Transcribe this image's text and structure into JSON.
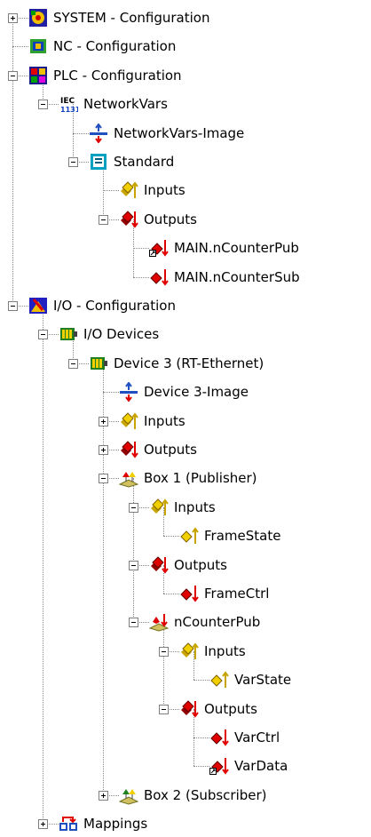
{
  "tree": {
    "selected_index": 30,
    "nodes": [
      {
        "label": "SYSTEM - Configuration",
        "icon": "system-config-icon",
        "depth": 0,
        "toggle": "plus"
      },
      {
        "label": "NC - Configuration",
        "icon": "nc-config-icon",
        "depth": 0,
        "toggle": ""
      },
      {
        "label": "PLC - Configuration",
        "icon": "plc-config-icon",
        "depth": 0,
        "toggle": "minus"
      },
      {
        "label": "NetworkVars",
        "icon": "iec-1131-icon",
        "depth": 1,
        "toggle": "minus"
      },
      {
        "label": "NetworkVars-Image",
        "icon": "process-image-icon",
        "depth": 2,
        "toggle": ""
      },
      {
        "label": "Standard",
        "icon": "standard-task-icon",
        "depth": 2,
        "toggle": "minus"
      },
      {
        "label": "Inputs",
        "icon": "inputs-icon",
        "depth": 3,
        "toggle": ""
      },
      {
        "label": "Outputs",
        "icon": "outputs-icon",
        "depth": 3,
        "toggle": "minus"
      },
      {
        "label": "MAIN.nCounterPub",
        "icon": "linked-output-variable-icon",
        "depth": 4,
        "toggle": ""
      },
      {
        "label": "MAIN.nCounterSub",
        "icon": "output-variable-icon",
        "depth": 4,
        "toggle": ""
      },
      {
        "label": "I/O - Configuration",
        "icon": "io-config-icon",
        "depth": 0,
        "toggle": "minus"
      },
      {
        "label": "I/O Devices",
        "icon": "io-devices-icon",
        "depth": 1,
        "toggle": "minus"
      },
      {
        "label": "Device 3 (RT-Ethernet)",
        "icon": "ethernet-device-icon",
        "depth": 2,
        "toggle": "minus"
      },
      {
        "label": "Device 3-Image",
        "icon": "process-image-icon",
        "depth": 3,
        "toggle": ""
      },
      {
        "label": "Inputs",
        "icon": "inputs-icon",
        "depth": 3,
        "toggle": "plus"
      },
      {
        "label": "Outputs",
        "icon": "outputs-icon",
        "depth": 3,
        "toggle": "plus"
      },
      {
        "label": "Box 1 (Publisher)",
        "icon": "publisher-box-icon",
        "depth": 3,
        "toggle": "minus"
      },
      {
        "label": "Inputs",
        "icon": "inputs-icon",
        "depth": 4,
        "toggle": "minus"
      },
      {
        "label": "FrameState",
        "icon": "input-variable-icon",
        "depth": 5,
        "toggle": ""
      },
      {
        "label": "Outputs",
        "icon": "outputs-icon",
        "depth": 4,
        "toggle": "minus"
      },
      {
        "label": "FrameCtrl",
        "icon": "output-variable-icon",
        "depth": 5,
        "toggle": ""
      },
      {
        "label": "nCounterPub",
        "icon": "network-variable-icon",
        "depth": 4,
        "toggle": "minus"
      },
      {
        "label": "Inputs",
        "icon": "inputs-icon",
        "depth": 5,
        "toggle": "minus"
      },
      {
        "label": "VarState",
        "icon": "input-variable-icon",
        "depth": 6,
        "toggle": ""
      },
      {
        "label": "Outputs",
        "icon": "outputs-icon",
        "depth": 5,
        "toggle": "minus"
      },
      {
        "label": "VarCtrl",
        "icon": "output-variable-icon",
        "depth": 6,
        "toggle": ""
      },
      {
        "label": "VarData",
        "icon": "linked-output-variable-icon",
        "depth": 6,
        "toggle": ""
      },
      {
        "label": "Box 2 (Subscriber)",
        "icon": "subscriber-box-icon",
        "depth": 3,
        "toggle": "plus"
      },
      {
        "label": "Mappings",
        "icon": "mappings-icon",
        "depth": 1,
        "toggle": "plus"
      }
    ]
  },
  "colors": {
    "selection_bg": "#0a246a",
    "selection_fg": "#ffffff",
    "tree_line": "#8a8a8a",
    "input_arrow": "#c8a400",
    "output_arrow": "#e00000"
  }
}
